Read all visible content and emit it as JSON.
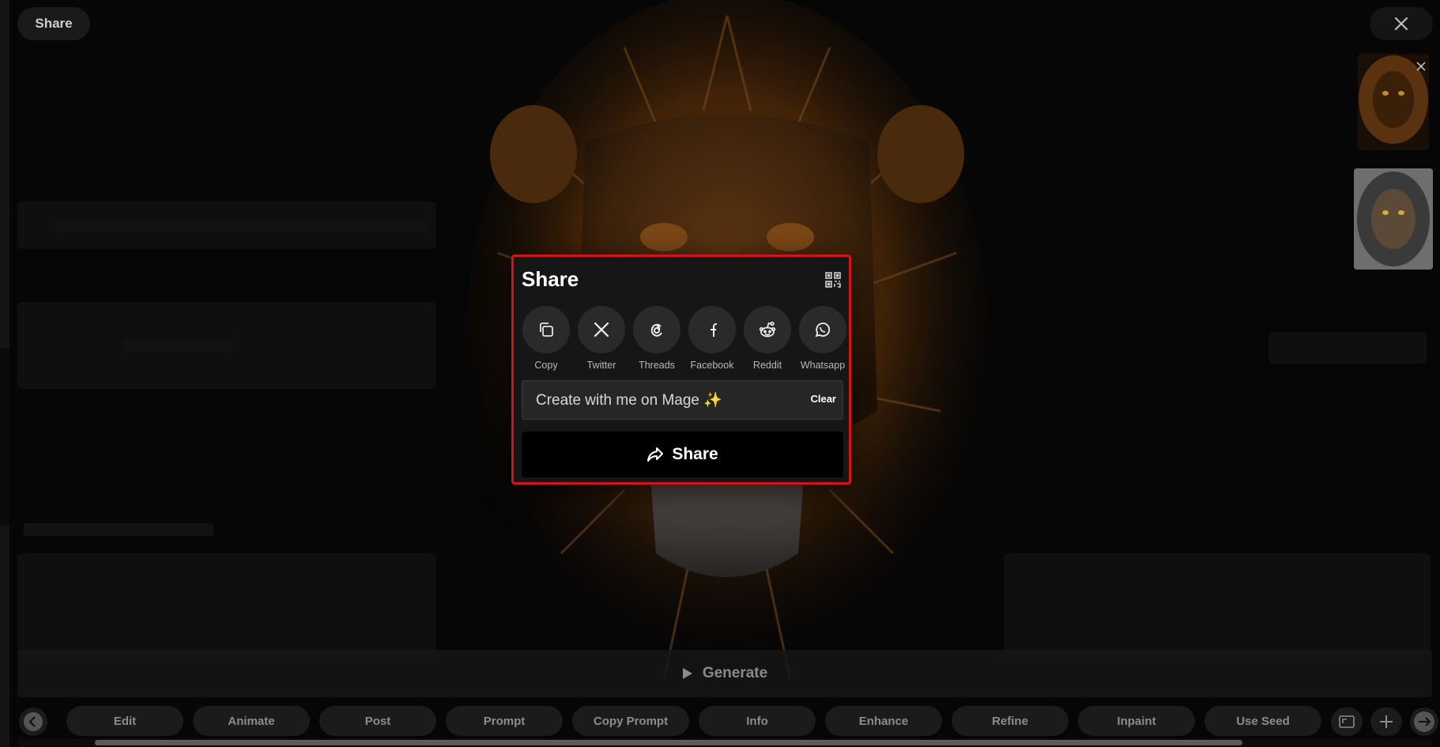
{
  "topbar": {
    "share_chip_label": "Share",
    "close_icon": "close-icon"
  },
  "modal": {
    "title": "Share",
    "qr_icon": "qr-code-icon",
    "targets": [
      {
        "label": "Copy",
        "icon": "copy-icon"
      },
      {
        "label": "Twitter",
        "icon": "x-logo-icon"
      },
      {
        "label": "Threads",
        "icon": "threads-logo-icon"
      },
      {
        "label": "Facebook",
        "icon": "facebook-logo-icon"
      },
      {
        "label": "Reddit",
        "icon": "reddit-logo-icon"
      },
      {
        "label": "Whatsapp",
        "icon": "whatsapp-logo-icon"
      }
    ],
    "message_value": "Create with me on Mage ✨",
    "clear_label": "Clear",
    "submit_label": "Share",
    "submit_icon": "share-arrow-icon",
    "highlight_color": "#d4141c"
  },
  "generate": {
    "label": "Generate",
    "icon": "play-icon"
  },
  "toolbar": {
    "buttons": [
      "Edit",
      "Animate",
      "Post",
      "Prompt",
      "Copy Prompt",
      "Info",
      "Enhance",
      "Refine",
      "Inpaint",
      "Use Seed"
    ],
    "left_icon": "chevron-left-icon",
    "right_icons": [
      "aspect-ratio-icon",
      "plus-icon",
      "arrow-right-icon"
    ]
  },
  "colors": {
    "background": "#060606",
    "modal_bg": "#161616",
    "circle_bg": "#2a2a2a"
  }
}
